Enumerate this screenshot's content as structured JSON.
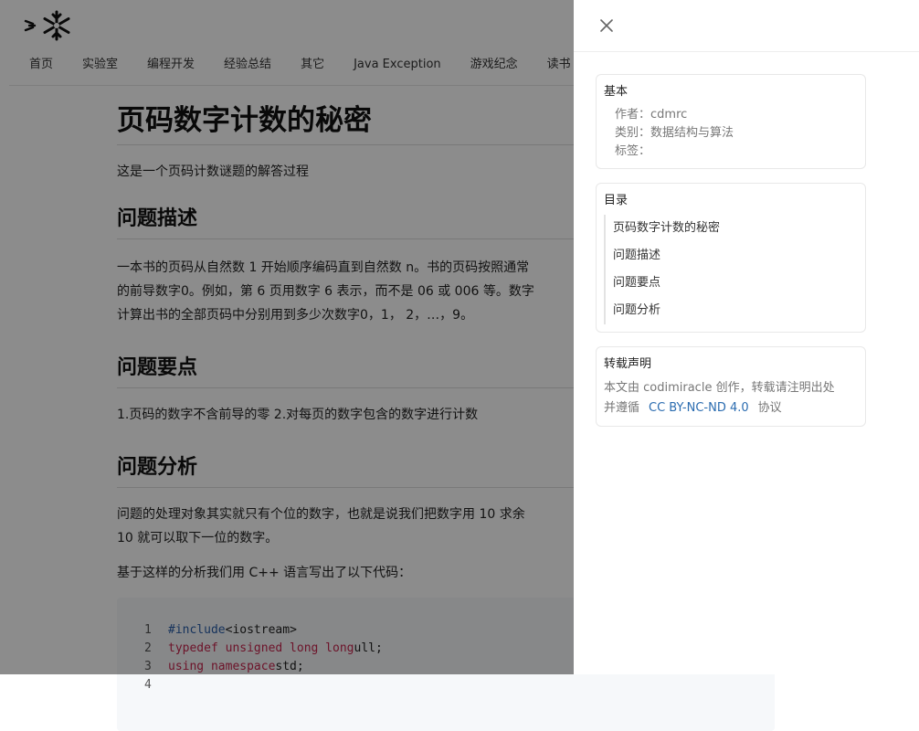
{
  "nav": {
    "items": [
      "首页",
      "实验室",
      "编程开发",
      "经验总结",
      "其它",
      "Java Exception",
      "游戏纪念",
      "读书"
    ]
  },
  "article": {
    "title": "页码数字计数的秘密",
    "lead": "这是一个页码计数谜题的解答过程",
    "h_desc": "问题描述",
    "desc_l1": "一本书的页码从自然数 1 开始顺序编码直到自然数 n。书的页码按照通常",
    "desc_l2": "的前导数字0。例如，第 6 页用数字 6 表示，而不是 06 或 006 等。数字",
    "desc_l3": "计算出书的全部页码中分别用到多少次数字0，1， 2，…，9。",
    "h_key": "问题要点",
    "key": "1.页码的数字不含前导的零 2.对每页的数字包含的数字进行计数",
    "h_ana": "问题分析",
    "ana_l1": "问题的处理对象其实就只有个位的数字，也就是说我们把数字用 10 求余",
    "ana_l2": "10 就可以取下一位的数字。",
    "ana_l3": "基于这样的分析我们用 C++ 语言写出了以下代码：",
    "code": [
      {
        "n": "1",
        "a": "#include",
        "b": " <iostream>"
      },
      {
        "n": "2",
        "a": "typedef unsigned long long",
        "b": " ull;"
      },
      {
        "n": "3",
        "a": "using namespace",
        "b": " std;"
      },
      {
        "n": "4",
        "a": "",
        "b": ""
      }
    ]
  },
  "drawer": {
    "basic_title": "基本",
    "author_label": "作者：",
    "author": "cdmrc",
    "category_label": "类别：",
    "category": "数据结构与算法",
    "tags_label": "标签：",
    "toc_title": "目录",
    "toc": [
      "页码数字计数的秘密",
      "问题描述",
      "问题要点",
      "问题分析"
    ],
    "license_title": "转载声明",
    "license_l1": "本文由 codimiracle 创作，转载请注明出处",
    "license_l2a": "并遵循",
    "license_link": "CC BY-NC-ND 4.0",
    "license_l2b": "协议"
  },
  "colors": {
    "overlay": "rgba(0,0,0,0.45)",
    "link": "#2b6cb0"
  },
  "icons": {
    "close": "close-icon",
    "logo": "snowflake-logo"
  }
}
